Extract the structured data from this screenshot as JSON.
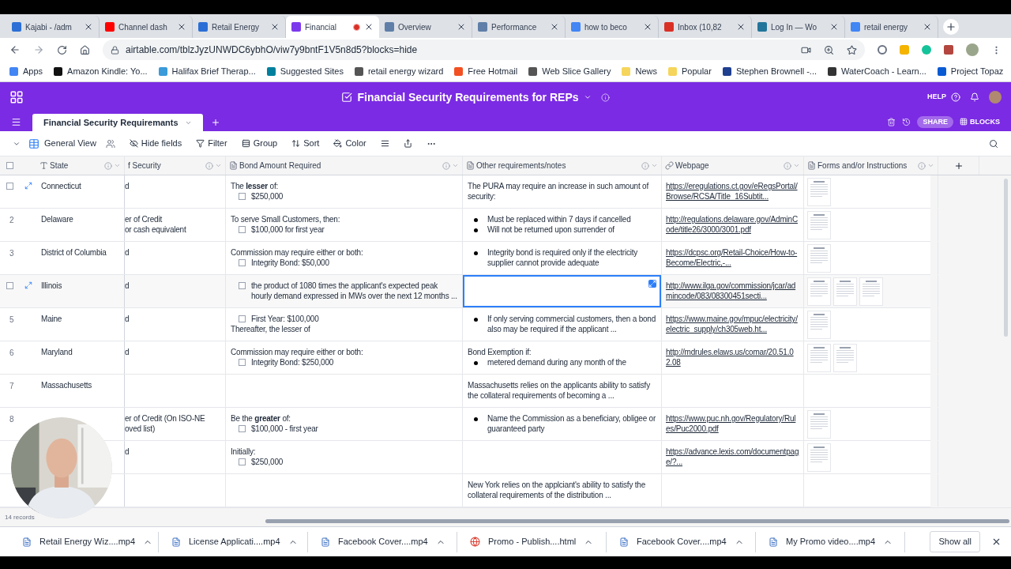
{
  "browser": {
    "tabs": [
      {
        "title": "Kajabi - /adm",
        "color": "#2b6fd6",
        "selected": false,
        "recording": false
      },
      {
        "title": "Channel dash",
        "color": "#ff0000",
        "selected": false,
        "recording": false
      },
      {
        "title": "Retail Energy",
        "color": "#2b6fd6",
        "selected": false,
        "recording": false
      },
      {
        "title": "Financial",
        "color": "#7c3aed",
        "selected": true,
        "recording": true
      },
      {
        "title": "Overview",
        "color": "#5f7fa8",
        "selected": false,
        "recording": false
      },
      {
        "title": "Performance",
        "color": "#5f7fa8",
        "selected": false,
        "recording": false
      },
      {
        "title": "how to beco",
        "color": "#4285f4",
        "selected": false,
        "recording": false
      },
      {
        "title": "Inbox (10,82",
        "color": "#d93025",
        "selected": false,
        "recording": false
      },
      {
        "title": "Log In — Wo",
        "color": "#21759b",
        "selected": false,
        "recording": false
      },
      {
        "title": "retail energy",
        "color": "#4285f4",
        "selected": false,
        "recording": false
      }
    ],
    "address": "airtable.com/tblzJyzUNWDC6ybhO/viw7y9bntF1V5n8d5?blocks=hide",
    "bookmarks": [
      {
        "label": "Apps",
        "color": "#4285f4"
      },
      {
        "label": "Amazon Kindle: Yo...",
        "color": "#111111"
      },
      {
        "label": "Halifax Brief Therap...",
        "color": "#3b9ad9"
      },
      {
        "label": "Suggested Sites",
        "color": "#00809d"
      },
      {
        "label": "retail energy wizard",
        "color": "#555555"
      },
      {
        "label": "Free Hotmail",
        "color": "#f25022"
      },
      {
        "label": "Web Slice Gallery",
        "color": "#555555"
      },
      {
        "label": "News",
        "color": "#f6d55c"
      },
      {
        "label": "Popular",
        "color": "#f6d55c"
      },
      {
        "label": "Stephen Brownell -...",
        "color": "#1f3f8f"
      },
      {
        "label": "WaterCoach - Learn...",
        "color": "#333333"
      },
      {
        "label": "Project Topaz",
        "color": "#0a5bd3"
      }
    ]
  },
  "app": {
    "base_title": "Financial Security Requirements for REPs",
    "help": "HELP",
    "table_tab": "Financial Security Requiremants",
    "share": "SHARE",
    "blocks": "BLOCKS",
    "view": "General View",
    "select_all_checked": false,
    "toolbar": [
      "Hide fields",
      "Filter",
      "Group",
      "Sort",
      "Color"
    ],
    "columns": [
      "State",
      "f Security",
      "Bond Amount Required",
      "Other requirements/notes",
      "Webpage",
      "Forms and/or Instructions"
    ],
    "rows": [
      {
        "hovered": true,
        "state": "Connecticut",
        "security": [
          "d"
        ],
        "bond": [
          {
            "kind": "text",
            "text": "The **lesser** of:"
          },
          {
            "kind": "check",
            "text": "$250,000",
            "checked": false
          }
        ],
        "notes": {
          "selected": false,
          "lines": [
            {
              "kind": "text",
              "text": "The PURA may require an increase in such amount of security:"
            }
          ]
        },
        "webpage": "https://eregulations.ct.gov/eRegsPortal/Browse/RCSA/Title_16Subtit...",
        "forms": [
          {
            "kind": "picture"
          }
        ]
      },
      {
        "hovered": false,
        "number": "2",
        "state": "Delaware",
        "security": [
          "er of Credit",
          "or cash equivalent"
        ],
        "bond": [
          {
            "kind": "text",
            "text": "To serve Small Customers, then:"
          },
          {
            "kind": "check",
            "text": "$100,000 for first year",
            "checked": false
          }
        ],
        "notes": {
          "selected": false,
          "lines": [
            {
              "kind": "bullet",
              "text": "Must be replaced within 7 days if cancelled"
            },
            {
              "kind": "bullet",
              "text": "Will not be returned upon surrender of"
            }
          ]
        },
        "webpage": "http://regulations.delaware.gov/AdminCode/title26/3000/3001.pdf",
        "forms": [
          {
            "kind": "picture"
          }
        ]
      },
      {
        "hovered": false,
        "number": "3",
        "state": "District of Columbia",
        "security": [
          "d"
        ],
        "bond": [
          {
            "kind": "text",
            "text": "Commission may require either or both:"
          },
          {
            "kind": "check",
            "text": "Integrity Bond: $50,000",
            "checked": false
          }
        ],
        "notes": {
          "selected": false,
          "lines": [
            {
              "kind": "bullet",
              "text": "Integrity bond is required only if the electricity supplier cannot provide adequate"
            }
          ]
        },
        "webpage": "https://dcpsc.org/Retail-Choice/How-to-Become/Electric,-...",
        "forms": [
          {
            "kind": "picture"
          }
        ]
      },
      {
        "hovered": true,
        "state": "Illinois",
        "security": [
          "d"
        ],
        "bond": [
          {
            "kind": "check",
            "text": "the product of 1080 times the applicant's expected peak hourly demand expressed in MWs over the next 12 months ...",
            "checked": false
          }
        ],
        "notes": {
          "selected": true
        },
        "webpage": "http://www.ilga.gov/commission/jcar/admincode/083/08300451secti...",
        "forms": [
          {
            "kind": "picture"
          },
          {
            "kind": "picture"
          },
          {
            "kind": "picture"
          }
        ]
      },
      {
        "hovered": false,
        "number": "5",
        "state": "Maine",
        "security": [
          "d"
        ],
        "bond": [
          {
            "kind": "check",
            "text": "First Year: $100,000",
            "checked": false
          },
          {
            "kind": "text",
            "text": "Thereafter, the lesser of"
          }
        ],
        "notes": {
          "selected": false,
          "lines": [
            {
              "kind": "bullet",
              "text": "If only serving commercial customers, then a bond also may be required if the applicant ..."
            }
          ]
        },
        "webpage": "https://www.maine.gov/mpuc/electricity/electric_supply/ch305web.ht...",
        "forms": [
          {
            "kind": "picture"
          }
        ]
      },
      {
        "hovered": false,
        "number": "6",
        "state": "Maryland",
        "security": [
          "d"
        ],
        "bond": [
          {
            "kind": "text",
            "text": "Commission may require either or both:"
          },
          {
            "kind": "check",
            "text": "Integrity Bond: $250,000",
            "checked": false
          }
        ],
        "notes": {
          "selected": false,
          "lines": [
            {
              "kind": "text",
              "text": "Bond Exemption if:"
            },
            {
              "kind": "bullet",
              "text": "metered demand during any month of the"
            }
          ]
        },
        "webpage": "http://mdrules.elaws.us/comar/20.51.02.08",
        "forms": [
          {
            "kind": "picture"
          },
          {
            "kind": "picture"
          }
        ]
      },
      {
        "hovered": false,
        "number": "7",
        "state": "Massachusetts",
        "security": [],
        "bond": [],
        "notes": {
          "selected": false,
          "lines": [
            {
              "kind": "text",
              "text": "Massachusetts relies on the applicants ability to satisfy the collateral requirements of becoming a ..."
            }
          ]
        },
        "forms": []
      },
      {
        "hovered": false,
        "number": "8",
        "security": [
          "er of Credit (On ISO-NE",
          "oved list)"
        ],
        "bond": [
          {
            "kind": "text",
            "text": "Be the **greater** of:"
          },
          {
            "kind": "check",
            "text": "$100,000 - first year",
            "checked": false
          }
        ],
        "notes": {
          "selected": false,
          "lines": [
            {
              "kind": "bullet",
              "text": "Name the Commission as a beneficiary, obligee or guaranteed party"
            }
          ]
        },
        "webpage": "https://www.puc.nh.gov/Regulatory/Rules/Puc2000.pdf",
        "forms": [
          {
            "kind": "picture"
          }
        ]
      },
      {
        "hovered": false,
        "security": [
          "d"
        ],
        "bond": [
          {
            "kind": "text",
            "text": "Initially:"
          },
          {
            "kind": "check",
            "text": "$250,000",
            "checked": false
          }
        ],
        "notes": {
          "selected": false
        },
        "webpage": "https://advance.lexis.com/documentpage/?...",
        "forms": [
          {
            "kind": "picture"
          }
        ]
      },
      {
        "hovered": false,
        "security": [],
        "bond": [],
        "notes": {
          "selected": false,
          "lines": [
            {
              "kind": "text",
              "text": "New York relies on the applciant's ability to satisfy the collateral requirements of the distribution ..."
            }
          ]
        },
        "forms": []
      }
    ],
    "record_count": "14 records"
  },
  "webcam": {
    "kind": "picture"
  },
  "downloads": [
    {
      "name": "Retail Energy Wiz....mp4",
      "kind": "file"
    },
    {
      "name": "License Applicati....mp4",
      "kind": "file"
    },
    {
      "name": "Facebook Cover....mp4",
      "kind": "file"
    },
    {
      "name": "Promo - Publish....html",
      "kind": "web"
    },
    {
      "name": "Facebook Cover....mp4",
      "kind": "file"
    },
    {
      "name": "My Promo video....mp4",
      "kind": "file"
    }
  ],
  "show_all": "Show all"
}
